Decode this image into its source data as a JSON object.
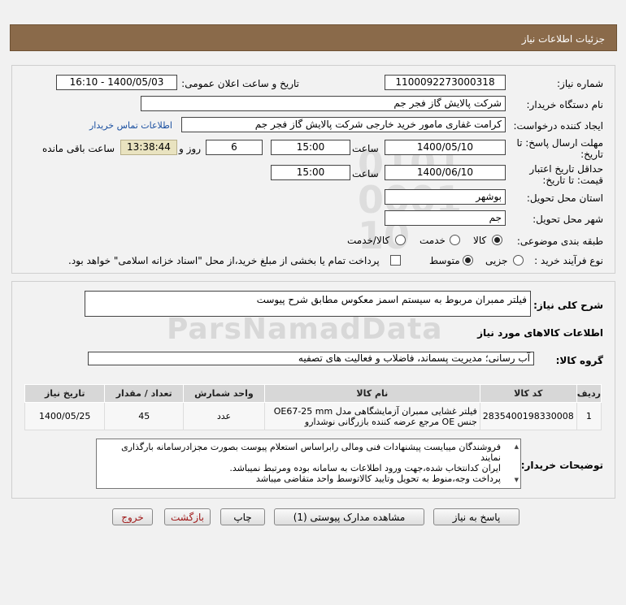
{
  "header": {
    "title": "جزئیات اطلاعات نیاز"
  },
  "fields": {
    "need_number_label": "شماره نیاز:",
    "need_number": "1100092273000318",
    "announce_label": "تاریخ و ساعت اعلان عمومی:",
    "announce_value": "1400/05/03 - 16:10",
    "buyer_org_label": "نام دستگاه خریدار:",
    "buyer_org": "شرکت پالایش گاز فجر جم",
    "creator_label": "ایجاد کننده درخواست:",
    "creator": "کرامت غفاری مامور خرید خارجی شرکت پالایش گاز فجر جم",
    "contact_link": "اطلاعات تماس خریدار",
    "deadline_label_1": "مهلت ارسال پاسخ: تا",
    "deadline_label_2": "تاریخ:",
    "deadline_date": "1400/05/10",
    "hour_label": "ساعت",
    "deadline_time": "15:00",
    "days_value": "6",
    "days_label": "روز و",
    "remaining_time": "13:38:44",
    "remaining_label": "ساعت باقی مانده",
    "validity_label_1": "حداقل تاریخ اعتبار",
    "validity_label_2": "قیمت: تا تاریخ:",
    "validity_date": "1400/06/10",
    "validity_hour_label": "ساعت",
    "validity_time": "15:00",
    "province_label": "استان محل تحویل:",
    "province": "بوشهر",
    "city_label": "شهر محل تحویل:",
    "city": "جم",
    "category_label": "طبقه بندی موضوعی:",
    "category_options": [
      "کالا",
      "خدمت",
      "کالا/خدمت"
    ],
    "process_label": "نوع فرآیند خرید :",
    "process_options": [
      "جزیی",
      "متوسط"
    ],
    "payment_note": "پرداخت تمام یا بخشی از مبلغ خرید،از محل \"اسناد خزانه اسلامی\" خواهد بود."
  },
  "summary": {
    "label": "شرح کلی نیاز:",
    "value": "فیلتر ممبران مربوط به سیستم اسمز معکوس مطابق شرح پیوست"
  },
  "goods_info": {
    "title": "اطلاعات کالاهای مورد نیاز",
    "group_label": "گروه کالا:",
    "group_value": "آب رسانی؛ مدیریت پسماند، فاضلاب و فعالیت های تصفیه"
  },
  "table": {
    "headers": [
      "ردیف",
      "کد کالا",
      "نام کالا",
      "واحد شمارش",
      "تعداد / مقدار",
      "تاریخ نیاز"
    ],
    "rows": [
      {
        "index": "1",
        "code": "2835400198330008",
        "name": "فیلتر غشایی ممبران آزمایشگاهی مدل OE67-25 mm جنس OE مرجع عرضه کننده بازرگانی نوشدارو",
        "unit": "عدد",
        "qty": "45",
        "date": "1400/05/25"
      }
    ]
  },
  "notes": {
    "label": "توضیحات خریدار:",
    "text": "فروشندگان میبایست پیشنهادات فنی ومالی رابراساس استعلام پیوست بصورت مجزادرسامانه بارگذاری نمایند\nایران کدانتخاب شده،جهت ورود اطلاعات به سامانه بوده ومرتبط نمیباشد.\nپرداخت وجه،منوط به تحویل وتایید کالاتوسط واحد متقاضی میباشد"
  },
  "buttons": {
    "reply": "پاسخ به نیاز",
    "view_docs": "مشاهده مدارک پیوستی (1)",
    "print": "چاپ",
    "back": "بازگشت",
    "exit": "خروج"
  },
  "watermark": "ParsNamadData",
  "colors": {
    "header_bg": "#8a6a4a",
    "link": "#1a4fa0",
    "exit_text": "#a01818",
    "remaining_bg": "#e9e3c0"
  }
}
